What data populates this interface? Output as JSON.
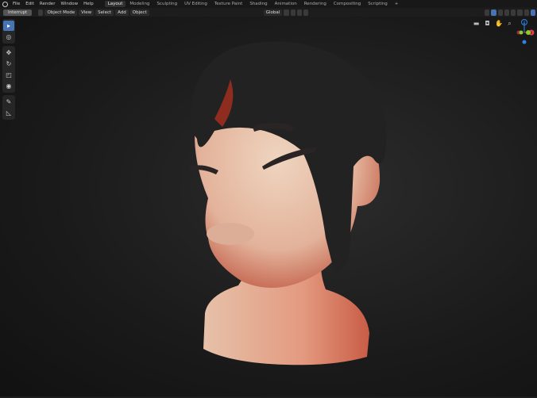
{
  "menu": [
    "File",
    "Edit",
    "Render",
    "Window",
    "Help"
  ],
  "tabs": [
    {
      "label": "Layout",
      "active": true
    },
    {
      "label": "Modeling"
    },
    {
      "label": "Sculpting"
    },
    {
      "label": "UV Editing"
    },
    {
      "label": "Texture Paint"
    },
    {
      "label": "Shading"
    },
    {
      "label": "Animation"
    },
    {
      "label": "Rendering"
    },
    {
      "label": "Compositing"
    },
    {
      "label": "Scripting"
    },
    {
      "label": "+"
    }
  ],
  "header": {
    "interrupt": "Interrupt",
    "mode": "Object Mode",
    "view": "View",
    "select": "Select",
    "add": "Add",
    "object": "Object",
    "orientation": "Global"
  },
  "tools": [
    "select-box",
    "cursor",
    "move",
    "rotate",
    "scale",
    "transform",
    "annotate",
    "measure"
  ],
  "gizmo": {
    "z": "Z",
    "x": "X",
    "y": "Y"
  },
  "colors": {
    "accent": "#4772b3",
    "x_axis": "#e8404f",
    "y_axis": "#8ccb2c",
    "z_axis": "#2f83e5"
  }
}
